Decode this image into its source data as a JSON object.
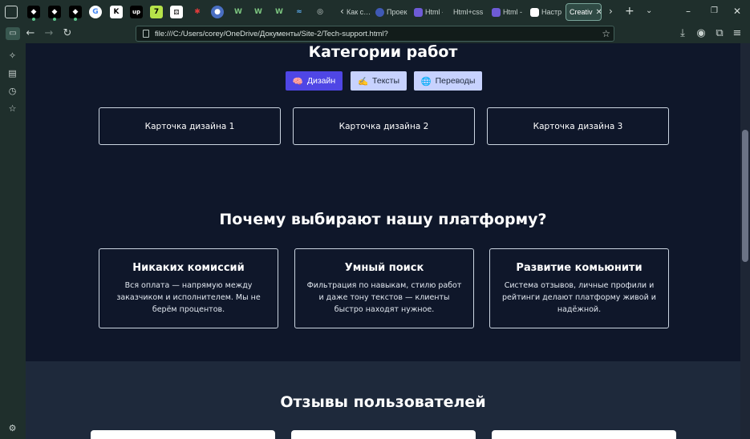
{
  "browser": {
    "tabs": [
      {
        "label": "Как с…"
      },
      {
        "label": "Проек"
      },
      {
        "label": "Html -"
      },
      {
        "label": "Html+css"
      },
      {
        "label": "Html -"
      },
      {
        "label": "Настр"
      },
      {
        "label": "Creativ",
        "active": true
      }
    ],
    "url": "file:///C:/Users/corey/OneDrive/Документы/Site-2/Tech-support.html?"
  },
  "categories": {
    "title": "Категории работ",
    "filters": [
      {
        "label": "Дизайн",
        "emoji": "🧠",
        "active": true
      },
      {
        "label": "Тексты",
        "emoji": "✍️",
        "active": false
      },
      {
        "label": "Переводы",
        "emoji": "🌐",
        "active": false
      }
    ],
    "cards": [
      "Карточка дизайна 1",
      "Карточка дизайна 2",
      "Карточка дизайна 3"
    ]
  },
  "why": {
    "title": "Почему выбирают нашу платформу?",
    "features": [
      {
        "title": "Никаких комиссий",
        "text": "Вся оплата — напрямую между заказчиком и исполнителем. Мы не берём процентов."
      },
      {
        "title": "Умный поиск",
        "text": "Фильтрация по навыкам, стилю работ и даже тону текстов — клиенты быстро находят нужное."
      },
      {
        "title": "Развитие комьюнити",
        "text": "Система отзывов, личные профили и рейтинги делают платформу живой и надёжной."
      }
    ]
  },
  "reviews": {
    "title": "Отзывы пользователей"
  },
  "colors": {
    "page_bg": "#0f172a",
    "section_alt_bg": "#1e293b",
    "filter_active": "#4f46e5",
    "filter_idle": "#c7d2fe",
    "browser_chrome": "#1f2f2c"
  }
}
